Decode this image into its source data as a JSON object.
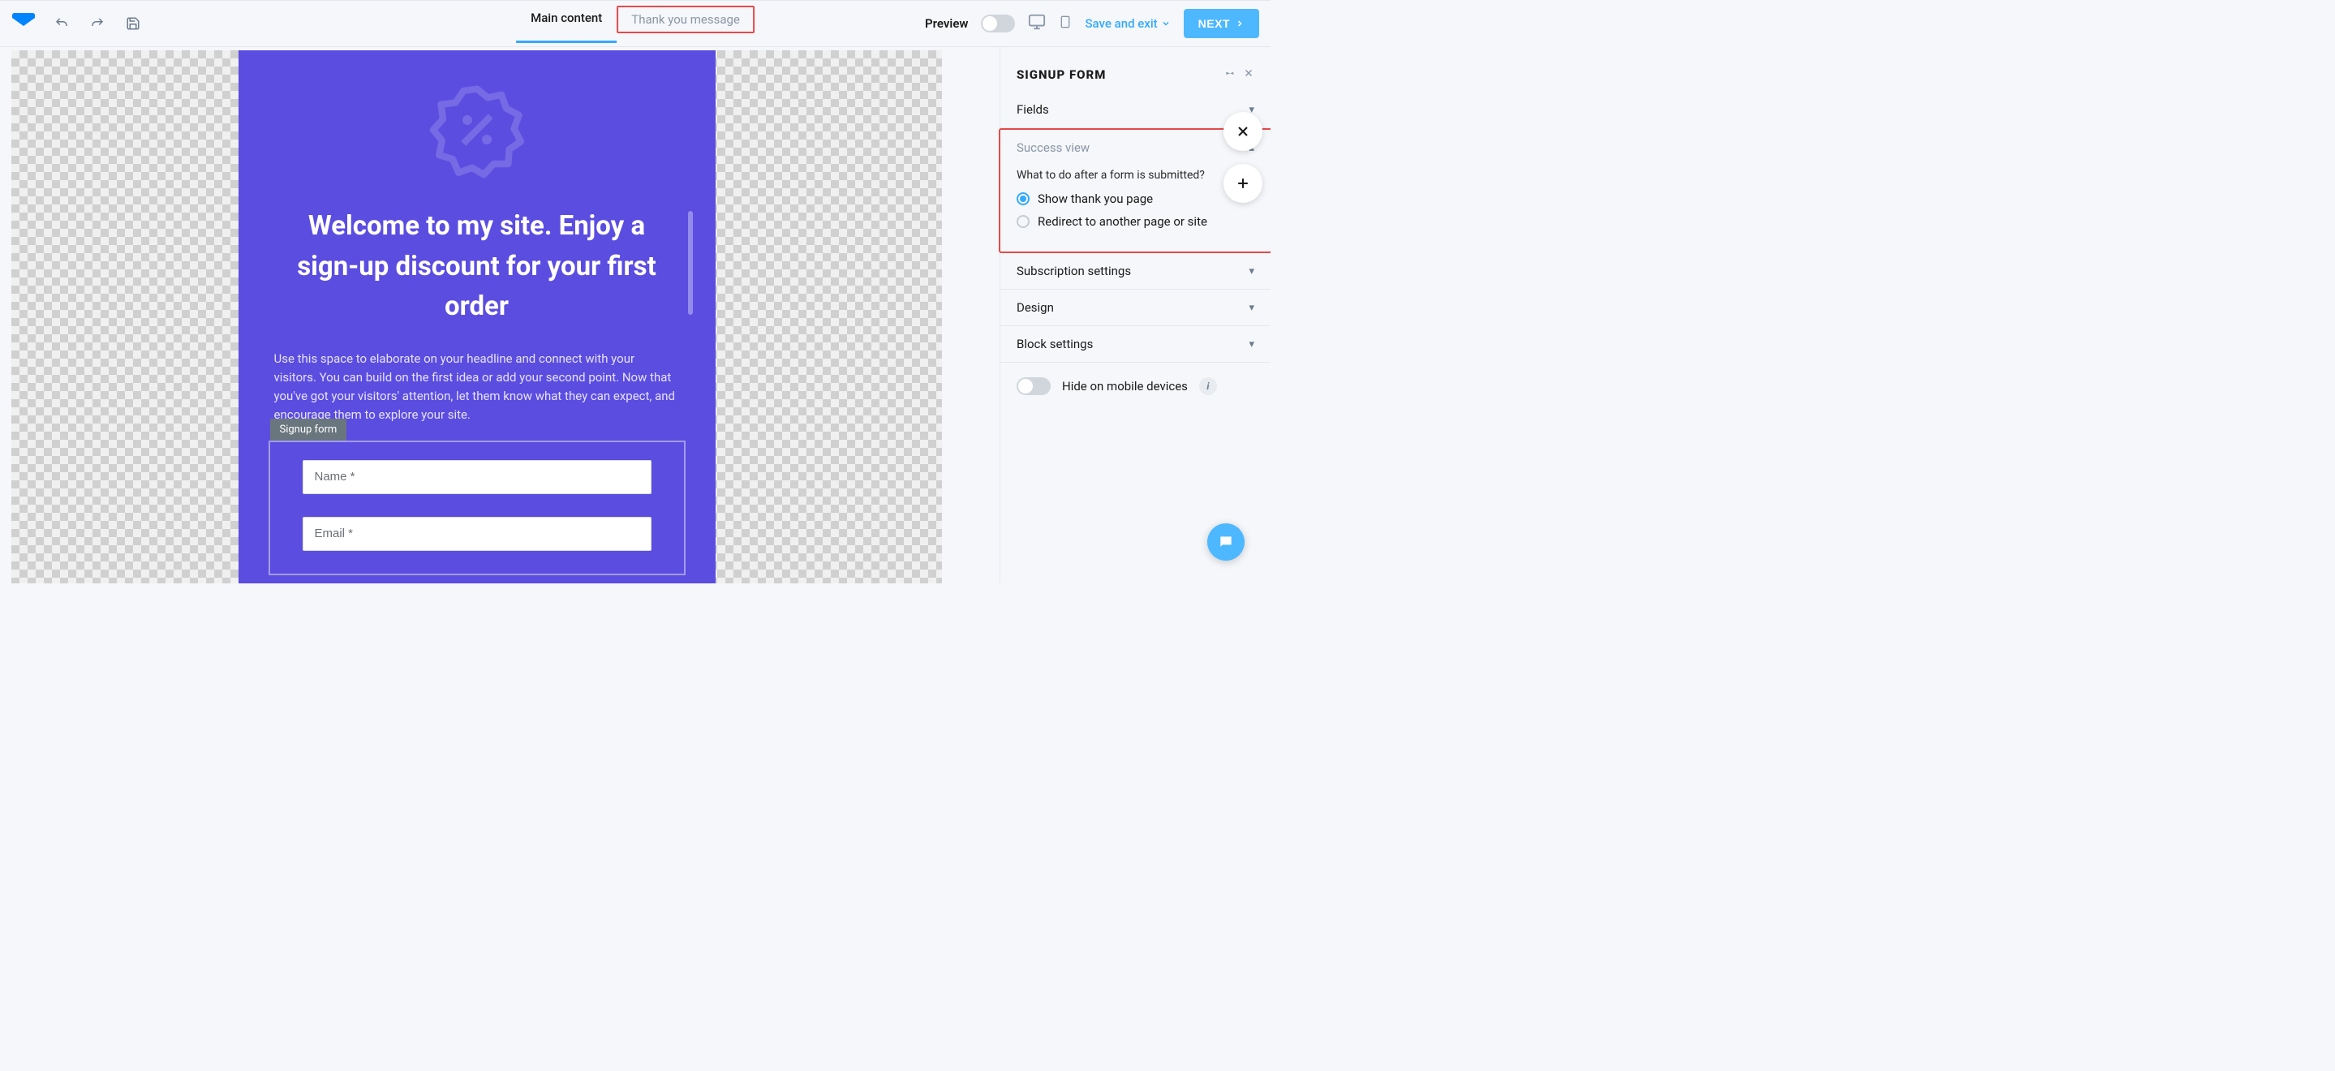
{
  "topbar": {
    "tabs": {
      "main": "Main content",
      "thankyou": "Thank you message"
    },
    "preview_label": "Preview",
    "save_exit": "Save and exit",
    "next": "NEXT"
  },
  "canvas": {
    "headline": "Welcome to my site. Enjoy a sign-up discount for your first order",
    "subtext": "Use this space to elaborate on your headline and connect with your visitors. You can build on the first idea or add your second point. Now that you've got your visitors' attention, let them know what they can expect, and encourage them to explore your site.",
    "form_block_label": "Signup form",
    "name_placeholder": "Name *",
    "email_placeholder": "Email *"
  },
  "sidebar": {
    "title": "SIGNUP FORM",
    "sections": {
      "fields": "Fields",
      "success_view": "Success view",
      "success_q": "What to do after a form is submitted?",
      "opt_thank": "Show thank you page",
      "opt_redirect": "Redirect to another page or site",
      "subscription": "Subscription settings",
      "design": "Design",
      "block": "Block settings"
    },
    "hide_mobile": "Hide on mobile devices"
  }
}
